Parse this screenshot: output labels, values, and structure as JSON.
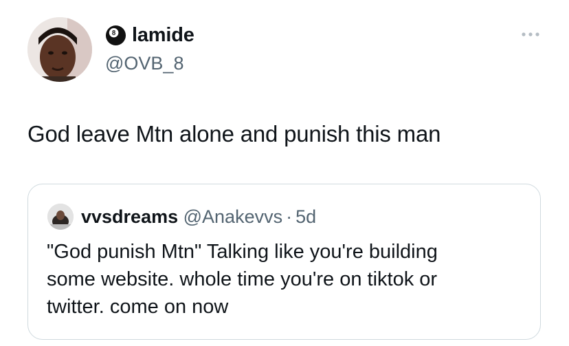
{
  "author": {
    "display_name": "lamide",
    "handle": "@OVB_8",
    "name_emoji_icon": "8-ball-icon",
    "avatar_icon": "profile-photo"
  },
  "tweet": {
    "text": "God leave Mtn alone and punish this man"
  },
  "menu": {
    "icon": "more-options-icon"
  },
  "quoted_tweet": {
    "display_name": "vvsdreams",
    "handle": "@Anakevvs",
    "separator": "·",
    "time": "5d",
    "text_lines": [
      "\"God punish Mtn\" Talking like you're building",
      "some website. whole time you're on tiktok or",
      "twitter. come on now"
    ]
  },
  "colors": {
    "text_primary": "#0f1419",
    "text_secondary": "#536471",
    "border": "#cfd9de",
    "background": "#ffffff"
  }
}
